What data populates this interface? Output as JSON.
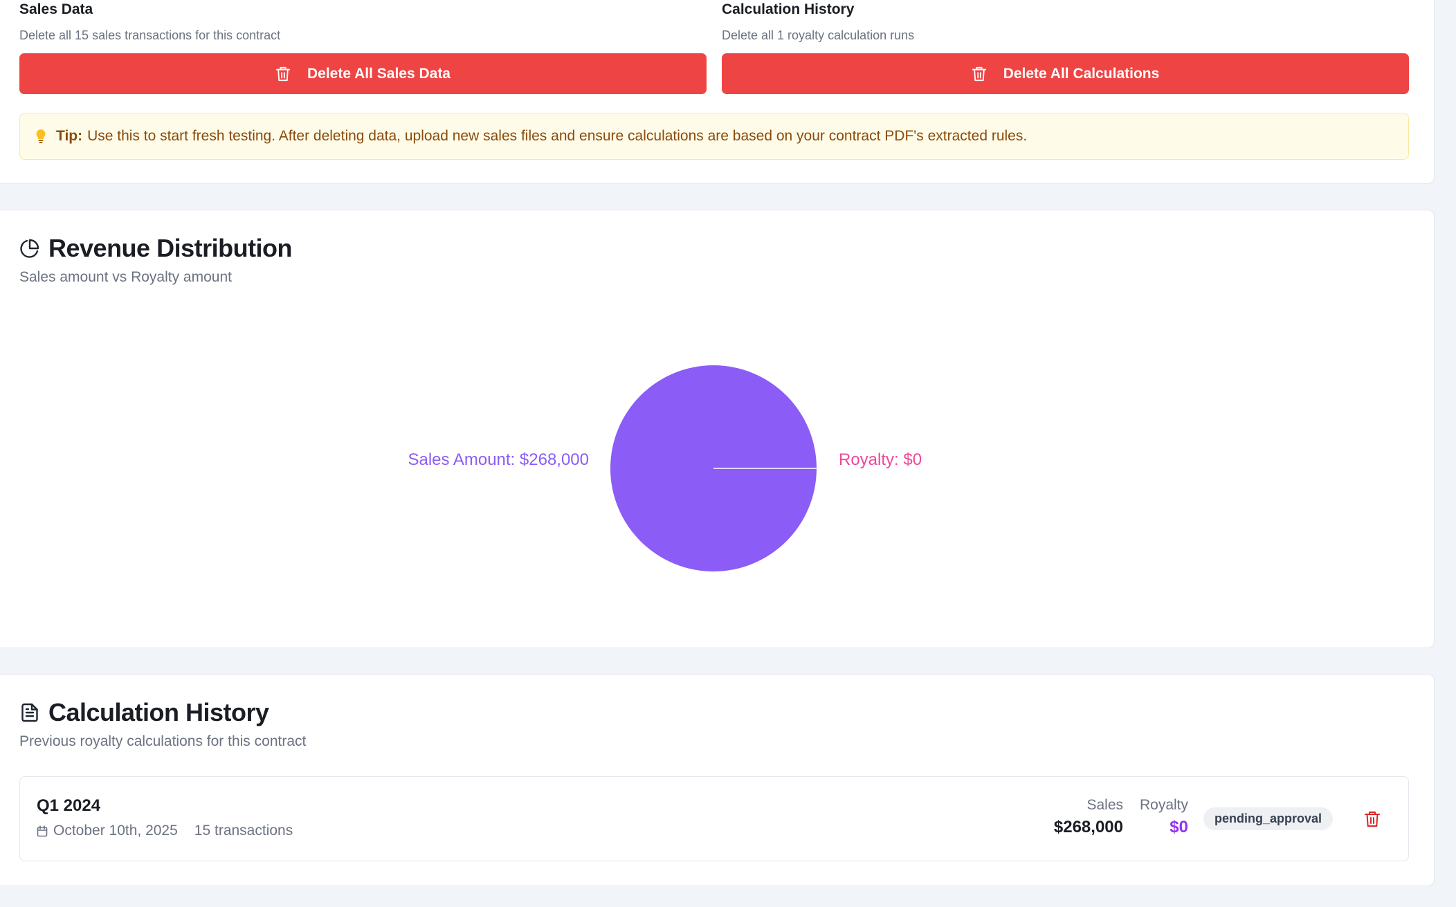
{
  "danger_zone": {
    "sales": {
      "title": "Sales Data",
      "description": "Delete all 15 sales transactions for this contract",
      "button_label": "Delete All Sales Data",
      "button_icon": "trash-icon"
    },
    "calculations": {
      "title": "Calculation History",
      "description": "Delete all 1 royalty calculation runs",
      "button_label": "Delete All Calculations",
      "button_icon": "trash-icon"
    },
    "tip": {
      "icon": "lightbulb-icon",
      "label": "Tip:",
      "text": "Use this to start fresh testing. After deleting data, upload new sales files and ensure calculations are based on your contract PDF's extracted rules."
    },
    "colors": {
      "danger": "#ef4444",
      "tip_bg": "#fefce8",
      "tip_text": "#8a4a0c"
    }
  },
  "revenue": {
    "icon": "pie-chart-icon",
    "title": "Revenue Distribution",
    "subtitle": "Sales amount vs Royalty amount",
    "labels": {
      "sales": "Sales Amount: $268,000",
      "royalty": "Royalty: $0"
    }
  },
  "chart_data": {
    "type": "pie",
    "title": "",
    "categories": [
      "Sales Amount",
      "Royalty"
    ],
    "values": [
      268000,
      0
    ],
    "colors": [
      "#8b5cf6",
      "#ec4899"
    ],
    "legend": "none"
  },
  "history": {
    "icon": "file-text-icon",
    "title": "Calculation History",
    "subtitle": "Previous royalty calculations for this contract",
    "rows": [
      {
        "period": "Q1 2024",
        "date": "October 10th, 2025",
        "transactions": "15 transactions",
        "sales_label": "Sales",
        "sales_value": "$268,000",
        "royalty_label": "Royalty",
        "royalty_value": "$0",
        "status": "pending_approval"
      }
    ],
    "colors": {
      "royalty": "#9333ea",
      "delete": "#dc2626"
    }
  }
}
